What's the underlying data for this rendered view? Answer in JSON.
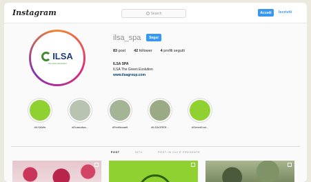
{
  "topbar": {
    "logo": "Instagram",
    "search_placeholder": "Search",
    "login_label": "Accedi",
    "signup_label": "Iscriviti"
  },
  "profile": {
    "username": "ilsa_spa",
    "follow_label": "Segui",
    "posts": "83",
    "posts_label": "post",
    "followers": "42",
    "followers_label": "follower",
    "following": "4",
    "following_label": "profili seguiti",
    "bio_name": "ILSA SPA",
    "bio_desc": "ILSA The Green Evolution",
    "bio_link": "www.ilsagroup.com",
    "avatar_logo_text": "ILSA",
    "avatar_logo_sub": "The Green Evolution"
  },
  "highlights": [
    {
      "label": "#ILSAWe",
      "color": "#8fd130"
    },
    {
      "label": "#Guanoilsa...",
      "color": "#b9c4b0"
    },
    {
      "label": "#Fertilizzanti",
      "color": "#a4b596"
    },
    {
      "label": "#ILSAGREE...",
      "color": "#9aaa84"
    },
    {
      "label": "#GreenEvol...",
      "color": "#8fd130"
    }
  ],
  "tabs": [
    {
      "label": "POST",
      "active": true
    },
    {
      "label": "IGTV",
      "active": false
    },
    {
      "label": "POST IN CUI È PRESENTE",
      "active": false
    }
  ]
}
